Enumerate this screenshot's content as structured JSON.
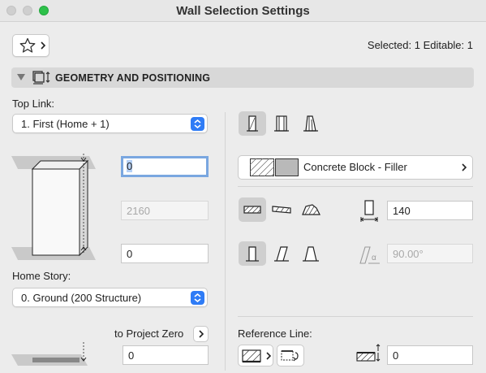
{
  "window": {
    "title": "Wall Selection Settings"
  },
  "favorites": {
    "icon": "star-icon"
  },
  "selection": {
    "status": "Selected: 1 Editable: 1"
  },
  "section": {
    "title": "GEOMETRY AND POSITIONING",
    "expanded": true
  },
  "geometry": {
    "top_link_label": "Top Link:",
    "top_link_value": "1. First (Home + 1)",
    "top_offset": "0",
    "height": "2160",
    "bottom_offset": "0",
    "home_story_label": "Home Story:",
    "home_story_value": "0. Ground (200 Structure)",
    "to_project_zero_label": "to Project Zero",
    "project_zero_value": "0"
  },
  "structure": {
    "material_name": "Concrete Block - Filler",
    "thickness": "140",
    "angle_placeholder": "90.00°",
    "reference_line_label": "Reference Line:",
    "reference_offset": "0"
  },
  "colors": {
    "accent": "#2f7cf6",
    "focus_ring": "#7aa7e0",
    "traffic_green": "#2dc14a"
  }
}
